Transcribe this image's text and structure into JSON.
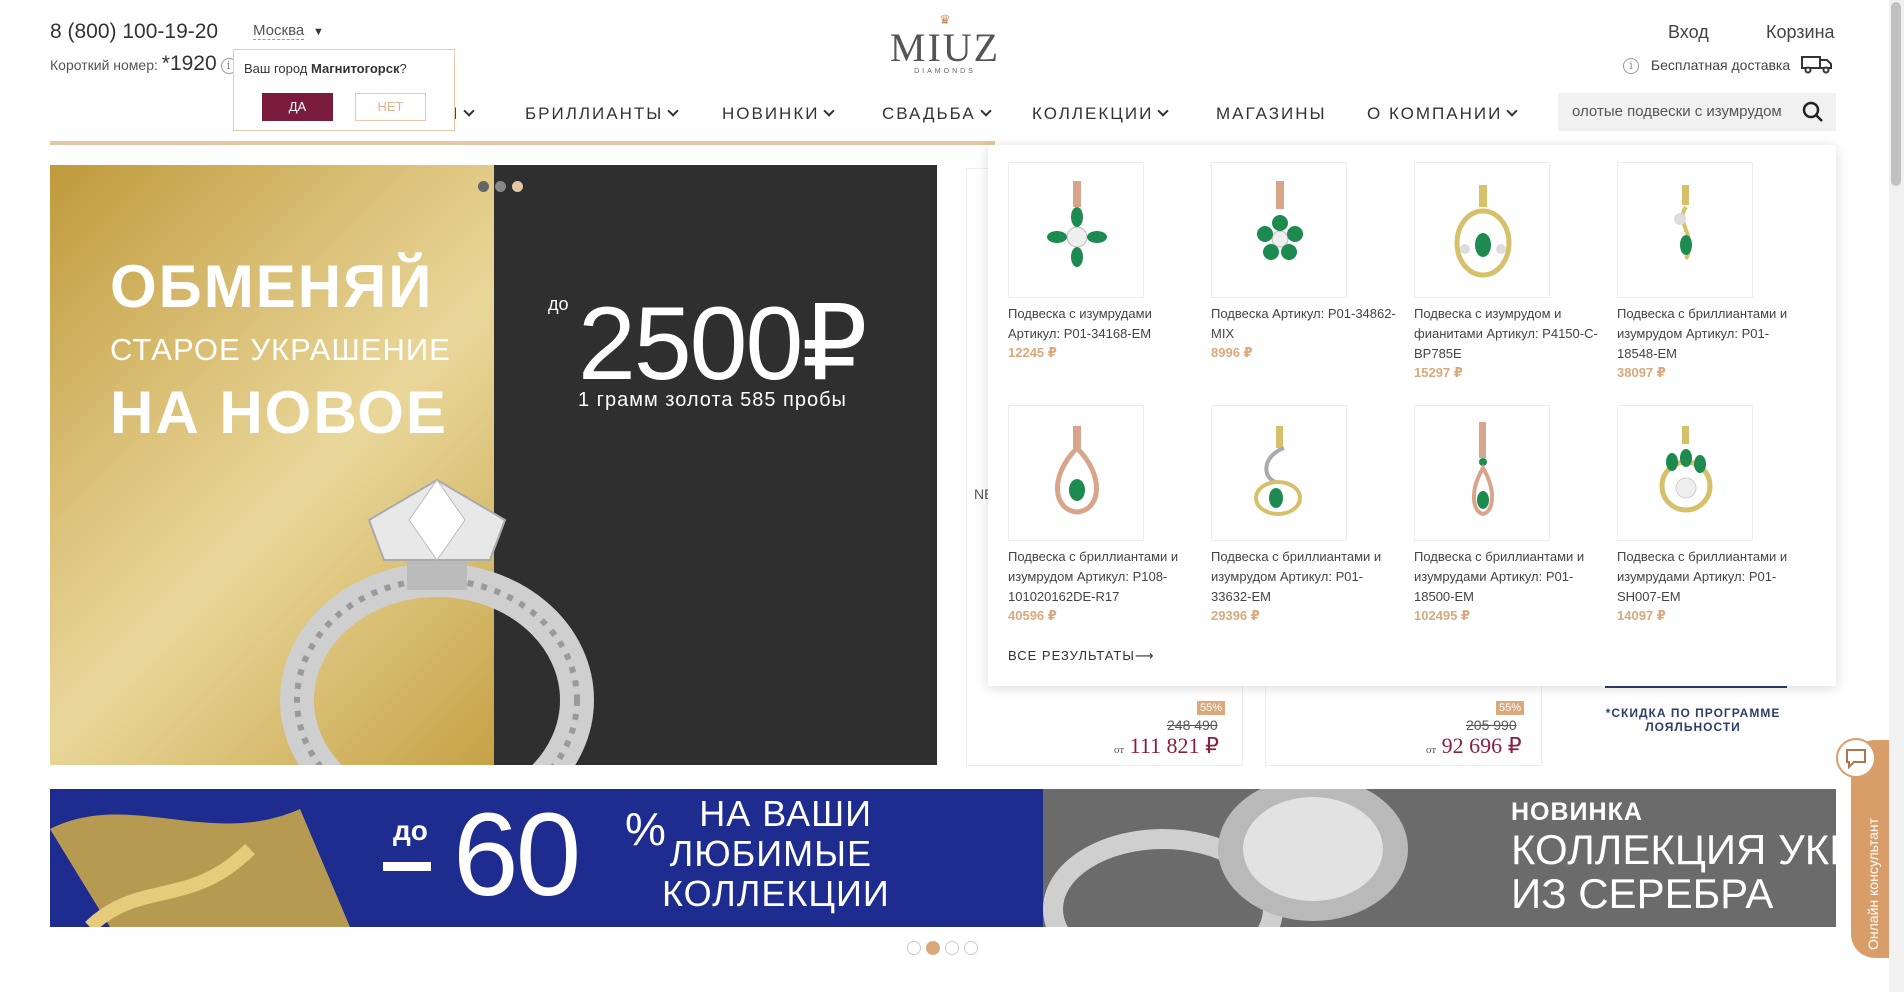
{
  "header": {
    "phone": "8 (800) 100-19-20",
    "short_label": "Короткий номер:",
    "short_number": "*1920",
    "city": "Москва",
    "login": "Вход",
    "cart": "Корзина",
    "shipping": "Бесплатная доставка"
  },
  "logo": {
    "brand": "MIUZ",
    "sub": "DIAMONDS"
  },
  "city_popup": {
    "question_prefix": "Ваш город ",
    "question_city": "Магнитогорск",
    "question_suffix": "?",
    "yes": "ДА",
    "no": "НЕТ"
  },
  "nav": {
    "item0_tail": "Я",
    "item1": "БРИЛЛИАНТЫ",
    "item2": "НОВИНКИ",
    "item3": "СВАДЬБА",
    "item4": "КОЛЛЕКЦИИ",
    "item5": "МАГАЗИНЫ",
    "item6": "О КОМПАНИИ"
  },
  "search": {
    "value": "олотые подвески с изумрудом"
  },
  "hero": {
    "line1": "ОБМЕНЯЙ",
    "line2": "СТАРОЕ УКРАШЕНИЕ",
    "line3": "НА НОВОЕ",
    "do": "до",
    "amount": "2500₽",
    "note": "1 грамм золота 585 пробы"
  },
  "side_products": [
    {
      "badge": "55%",
      "old_price": "248 490",
      "prefix": "от",
      "price": "111 821 ₽"
    },
    {
      "badge": "55%",
      "old_price": "205 990",
      "prefix": "от",
      "price": "92 696 ₽"
    }
  ],
  "side_label": "NE",
  "loyalty": "*СКИДКА ПО ПРОГРАММЕ ЛОЯЛЬНОСТИ",
  "dropdown": {
    "items": [
      {
        "name": "Подвеска с изумрудами Артикул: P01-34168-EM",
        "price": "12245 ₽"
      },
      {
        "name": "Подвеска Артикул: P01-34862-MIX",
        "price": "8996 ₽"
      },
      {
        "name": "Подвеска с изумрудом и фианитами Артикул: P4150-C-BP785E",
        "price": "15297 ₽"
      },
      {
        "name": "Подвеска с бриллиантами и изумрудом Артикул: P01-18548-EM",
        "price": "38097 ₽"
      },
      {
        "name": "Подвеска с бриллиантами и изумрудом Артикул: P108-10102016​2DE-R17",
        "price": "40596 ₽"
      },
      {
        "name": "Подвеска с бриллиантами и изумрудом Артикул: P01-33632-EM",
        "price": "29396 ₽"
      },
      {
        "name": "Подвеска с бриллиантами и изумрудами Артикул: P01-18500-EM",
        "price": "102495 ₽"
      },
      {
        "name": "Подвеска с бриллиантами и изумрудами Артикул: P01-SH007-EM",
        "price": "14097 ₽"
      }
    ],
    "all_results": "ВСЕ РЕЗУЛЬТАТЫ⟶"
  },
  "banners": {
    "sale_do": "до",
    "sale_value": "60",
    "sale_pct": "%",
    "sale_line1": "НА ВАШИ",
    "sale_line2": "ЛЮБИМЫЕ",
    "sale_line3": "КОЛЛЕКЦИИ",
    "new_label": "НОВИНКА",
    "new_line1": "КОЛЛЕКЦИЯ УКРА",
    "new_line2": "ИЗ СЕРЕБРА"
  },
  "consultant": "Онлайн консультант",
  "colors": {
    "brand": "#7b1b3c",
    "gold": "#d9a97c",
    "navy": "#1d2c8e"
  }
}
